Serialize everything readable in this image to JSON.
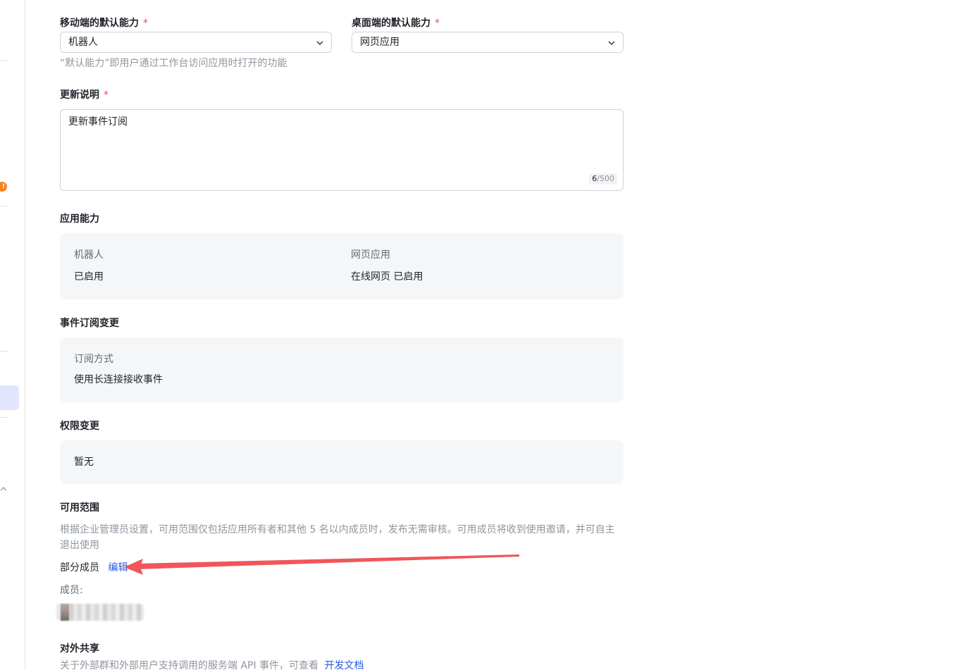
{
  "sidebar": {
    "badge": "!"
  },
  "form": {
    "mobile_default": {
      "label": "移动端的默认能力",
      "required_mark": "*",
      "value": "机器人"
    },
    "desktop_default": {
      "label": "桌面端的默认能力",
      "required_mark": "*",
      "value": "网页应用"
    },
    "default_hint": "“默认能力”即用户通过工作台访问应用时打开的功能",
    "update_notes": {
      "label": "更新说明",
      "required_mark": "*",
      "value": "更新事件订阅",
      "count": "6",
      "max": "/500"
    }
  },
  "capabilities": {
    "title": "应用能力",
    "items": [
      {
        "name": "机器人",
        "status": "已启用"
      },
      {
        "name": "网页应用",
        "status": "在线网页 已启用"
      }
    ]
  },
  "event_subscription": {
    "title": "事件订阅变更",
    "key": "订阅方式",
    "value": "使用长连接接收事件"
  },
  "permissions": {
    "title": "权限变更",
    "value": "暂无"
  },
  "availability": {
    "title": "可用范围",
    "hint": "根据企业管理员设置，可用范围仅包括应用所有者和其他 5 名以内成员时，发布无需审核。可用成员将收到使用邀请，并可自主退出使用",
    "scope_label": "部分成员",
    "edit_link": "编辑",
    "members_label": "成员:"
  },
  "external_sharing": {
    "title": "对外共享",
    "hint": "关于外部群和外部用户支持调用的服务端 API 事件，可查看",
    "doc_link": "开发文档"
  },
  "colors": {
    "accent": "#245bdb",
    "required": "#f54a45",
    "annotation_arrow": "#f0565a"
  }
}
